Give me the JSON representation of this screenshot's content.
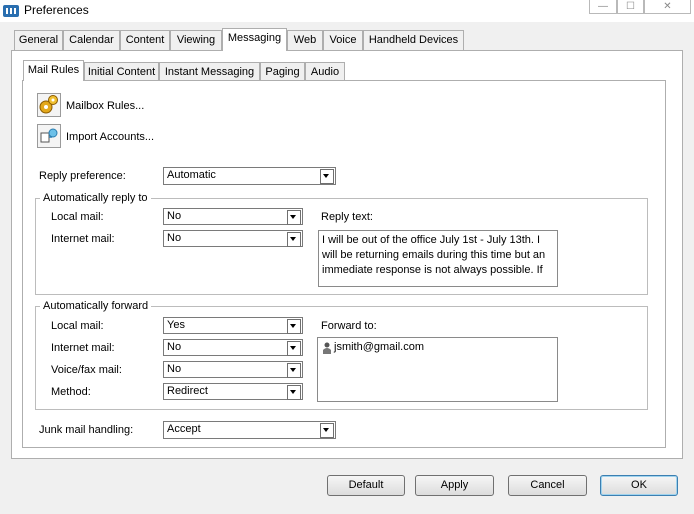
{
  "window": {
    "title": "Preferences"
  },
  "colors": {
    "default_button_border": "#3c7fb1",
    "panel_bg": "#ffffff",
    "window_bg": "#f0f0f0"
  },
  "main_tabs": [
    "General",
    "Calendar",
    "Content",
    "Viewing",
    "Messaging",
    "Web",
    "Voice",
    "Handheld Devices"
  ],
  "sub_tabs": [
    "Mail Rules",
    "Initial Content",
    "Instant Messaging",
    "Paging",
    "Audio"
  ],
  "actions": {
    "mailbox_rules": "Mailbox Rules...",
    "import_accounts": "Import Accounts..."
  },
  "reply_preference": {
    "label": "Reply preference:",
    "value": "Automatic"
  },
  "auto_reply": {
    "title": "Automatically reply to",
    "local_label": "Local mail:",
    "local_value": "No",
    "internet_label": "Internet mail:",
    "internet_value": "No",
    "reply_text_label": "Reply text:",
    "reply_text": "I will be out of the office July 1st - July 13th. I will be returning emails during this time but an immediate response is not always possible.  If"
  },
  "auto_forward": {
    "title": "Automatically forward",
    "local_label": "Local mail:",
    "local_value": "Yes",
    "internet_label": "Internet mail:",
    "internet_value": "No",
    "voice_label": "Voice/fax mail:",
    "voice_value": "No",
    "method_label": "Method:",
    "method_value": "Redirect",
    "forward_to_label": "Forward to:",
    "forward_to": [
      "jsmith@gmail.com"
    ]
  },
  "junk": {
    "label": "Junk mail handling:",
    "value": "Accept"
  },
  "buttons": {
    "default": "Default",
    "apply": "Apply",
    "cancel": "Cancel",
    "ok": "OK"
  }
}
